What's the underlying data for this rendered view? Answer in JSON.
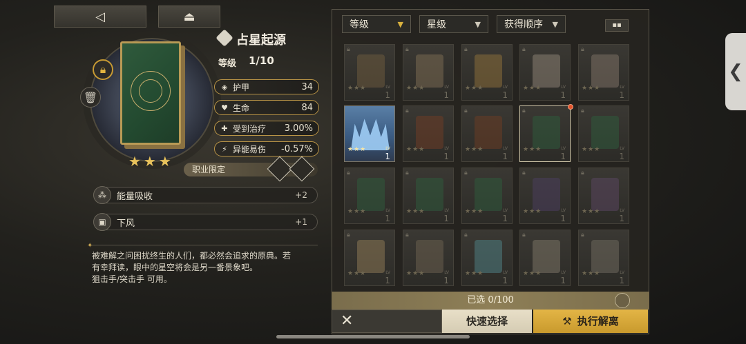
{
  "nav": {
    "back_icon": "◁",
    "up_icon": "⏏"
  },
  "item": {
    "title": "占星起源",
    "level_label": "等级",
    "level_value": "1/10",
    "stars": "★★★"
  },
  "stats": [
    {
      "icon": "shield-icon",
      "glyph": "◈",
      "name": "护甲",
      "value": "34"
    },
    {
      "icon": "heart-icon",
      "glyph": "♥",
      "name": "生命",
      "value": "84"
    },
    {
      "icon": "heal-icon",
      "glyph": "✚",
      "name": "受到治疗",
      "value": "3.00%"
    },
    {
      "icon": "anomaly-icon",
      "glyph": "⚡",
      "name": "异能易伤",
      "value": "-0.57%"
    }
  ],
  "job": {
    "label": "职业限定"
  },
  "perks": [
    {
      "name": "能量吸收",
      "value": "+2"
    },
    {
      "name": "下风",
      "value": "+1"
    }
  ],
  "description": {
    "line1": "被难解之问困扰终生的人们，都必然会追求的原典。若",
    "line2": "有幸拜读，眼中的星空将会是另一番景象吧。",
    "line3": "狙击手/突击手 可用。"
  },
  "filters": [
    {
      "label": "等级"
    },
    {
      "label": "星级"
    },
    {
      "label": "获得顺序"
    }
  ],
  "grid_toggle": "▪▪",
  "slots": [
    {
      "art": "#6b5a3e",
      "stars": "★★★",
      "lv": "LV",
      "num": "1"
    },
    {
      "art": "#7a6a52",
      "stars": "★★★",
      "lv": "LV",
      "num": "1"
    },
    {
      "art": "#8a6e3a",
      "stars": "★★★",
      "lv": "LV",
      "num": "1"
    },
    {
      "art": "#8a7f72",
      "stars": "★★★",
      "lv": "LV",
      "num": "1"
    },
    {
      "art": "#7c7064",
      "stars": "★★★",
      "lv": "LV",
      "num": "1"
    },
    {
      "art": "#9ac7ef",
      "stars": "★★★",
      "lv": "LV",
      "num": "1"
    },
    {
      "art": "#6e3d26",
      "stars": "★★★",
      "lv": "LV",
      "num": "1"
    },
    {
      "art": "#6a3c24",
      "stars": "★★★",
      "lv": "LV",
      "num": "1"
    },
    {
      "art": "#2f5a3c",
      "stars": "★★★",
      "lv": "LV",
      "num": "1"
    },
    {
      "art": "#2f5a3c",
      "stars": "★★★",
      "lv": "LV",
      "num": "1"
    },
    {
      "art": "#2f5a3c",
      "stars": "★★★",
      "lv": "LV",
      "num": "1"
    },
    {
      "art": "#2f5a3c",
      "stars": "★★★",
      "lv": "LV",
      "num": "1"
    },
    {
      "art": "#2f5a3c",
      "stars": "★★★",
      "lv": "LV",
      "num": "1"
    },
    {
      "art": "#4a3e5c",
      "stars": "★★★",
      "lv": "LV",
      "num": "1"
    },
    {
      "art": "#5a465e",
      "stars": "★★★",
      "lv": "LV",
      "num": "1"
    },
    {
      "art": "#8a7654",
      "stars": "★★★",
      "lv": "LV",
      "num": "1"
    },
    {
      "art": "#6a5e4e",
      "stars": "★★★",
      "lv": "LV",
      "num": "1"
    },
    {
      "art": "#4e7e82",
      "stars": "★★★",
      "lv": "LV",
      "num": "1"
    },
    {
      "art": "#7a7264",
      "stars": "★★★",
      "lv": "LV",
      "num": "1"
    },
    {
      "art": "#6e685c",
      "stars": "★★★",
      "lv": "LV",
      "num": "1"
    }
  ],
  "selection": {
    "label": "已选 0/100"
  },
  "buttons": {
    "close": "✕",
    "quick_select": "快速选择",
    "execute": "执行解离"
  },
  "side_tab": "❮"
}
